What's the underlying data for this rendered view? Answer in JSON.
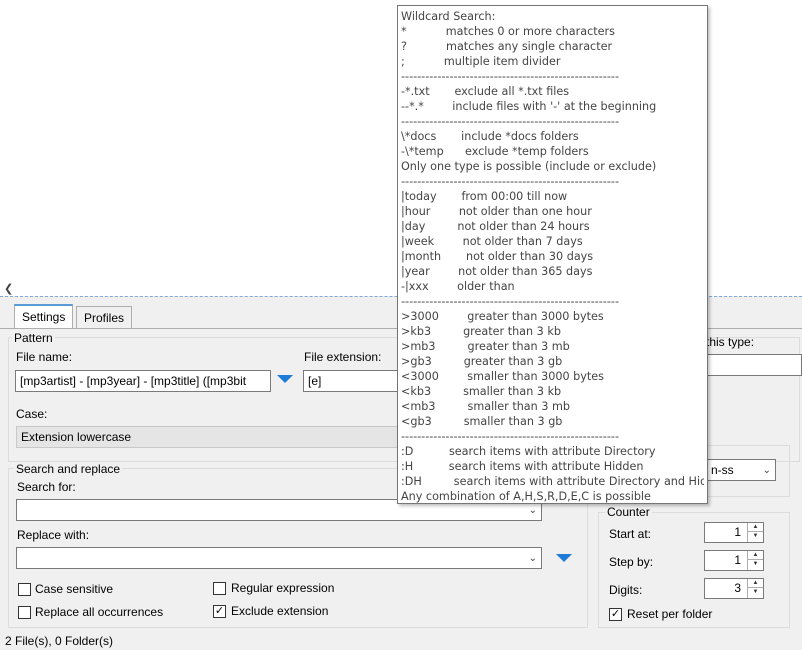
{
  "tabs": [
    "Settings",
    "Profiles"
  ],
  "pattern": {
    "title": "Pattern",
    "file_name_label": "File name:",
    "file_name_value": "[mp3artist] - [mp3year] - [mp3title] ([mp3bit",
    "file_ext_label": "File extension:",
    "file_ext_value": "[e]",
    "case_label": "Case:",
    "case_value": "Extension lowercase",
    "this_type_label": "this type:"
  },
  "search_replace": {
    "title": "Search and replace",
    "search_label": "Search for:",
    "search_value": "",
    "replace_label": "Replace with:",
    "replace_value": "",
    "case_sensitive": {
      "label": "Case sensitive",
      "checked": false
    },
    "replace_all": {
      "label": "Replace all occurrences",
      "checked": false
    },
    "regex": {
      "label": "Regular expression",
      "checked": false
    },
    "exclude_ext": {
      "label": "Exclude extension",
      "checked": true
    }
  },
  "datetime_combo_value": "n-ss",
  "counter": {
    "title": "Counter",
    "start_label": "Start at:",
    "start_value": "1",
    "step_label": "Step by:",
    "step_value": "1",
    "digits_label": "Digits:",
    "digits_value": "3",
    "reset_label": "Reset per folder",
    "reset_checked": true
  },
  "status": "2 File(s), 0 Folder(s)",
  "tooltip": {
    "lines": [
      "Wildcard Search:",
      "*           matches 0 or more characters",
      "?           matches any single character",
      ";           multiple item divider",
      "------------------------------------------------------",
      "-*.txt       exclude all *.txt files",
      "--*.*        include files with '-' at the beginning",
      "------------------------------------------------------",
      "\\*docs       include *docs folders",
      "-\\*temp      exclude *temp folders",
      "Only one type is possible (include or exclude)",
      "------------------------------------------------------",
      "|today       from 00:00 till now",
      "|hour        not older than one hour",
      "|day         not older than 24 hours",
      "|week        not older than 7 days",
      "|month       not older than 30 days",
      "|year        not older than 365 days",
      "-|xxx        older than",
      "------------------------------------------------------",
      ">3000        greater than 3000 bytes",
      ">kb3         greater than 3 kb",
      ">mb3         greater than 3 mb",
      ">gb3         greater than 3 gb",
      "<3000        smaller than 3000 bytes",
      "<kb3         smaller than 3 kb",
      "<mb3         smaller than 3 mb",
      "<gb3         smaller than 3 gb",
      "------------------------------------------------------",
      ":D          search items with attribute Directory",
      ":H          search items with attribute Hidden",
      ":DH         search items with attribute Directory and Hidden",
      "Any combination of A,H,S,R,D,E,C is possible"
    ]
  },
  "colors": {
    "accent": "#1e7bd8",
    "panel_bg": "#f0f0f0"
  }
}
